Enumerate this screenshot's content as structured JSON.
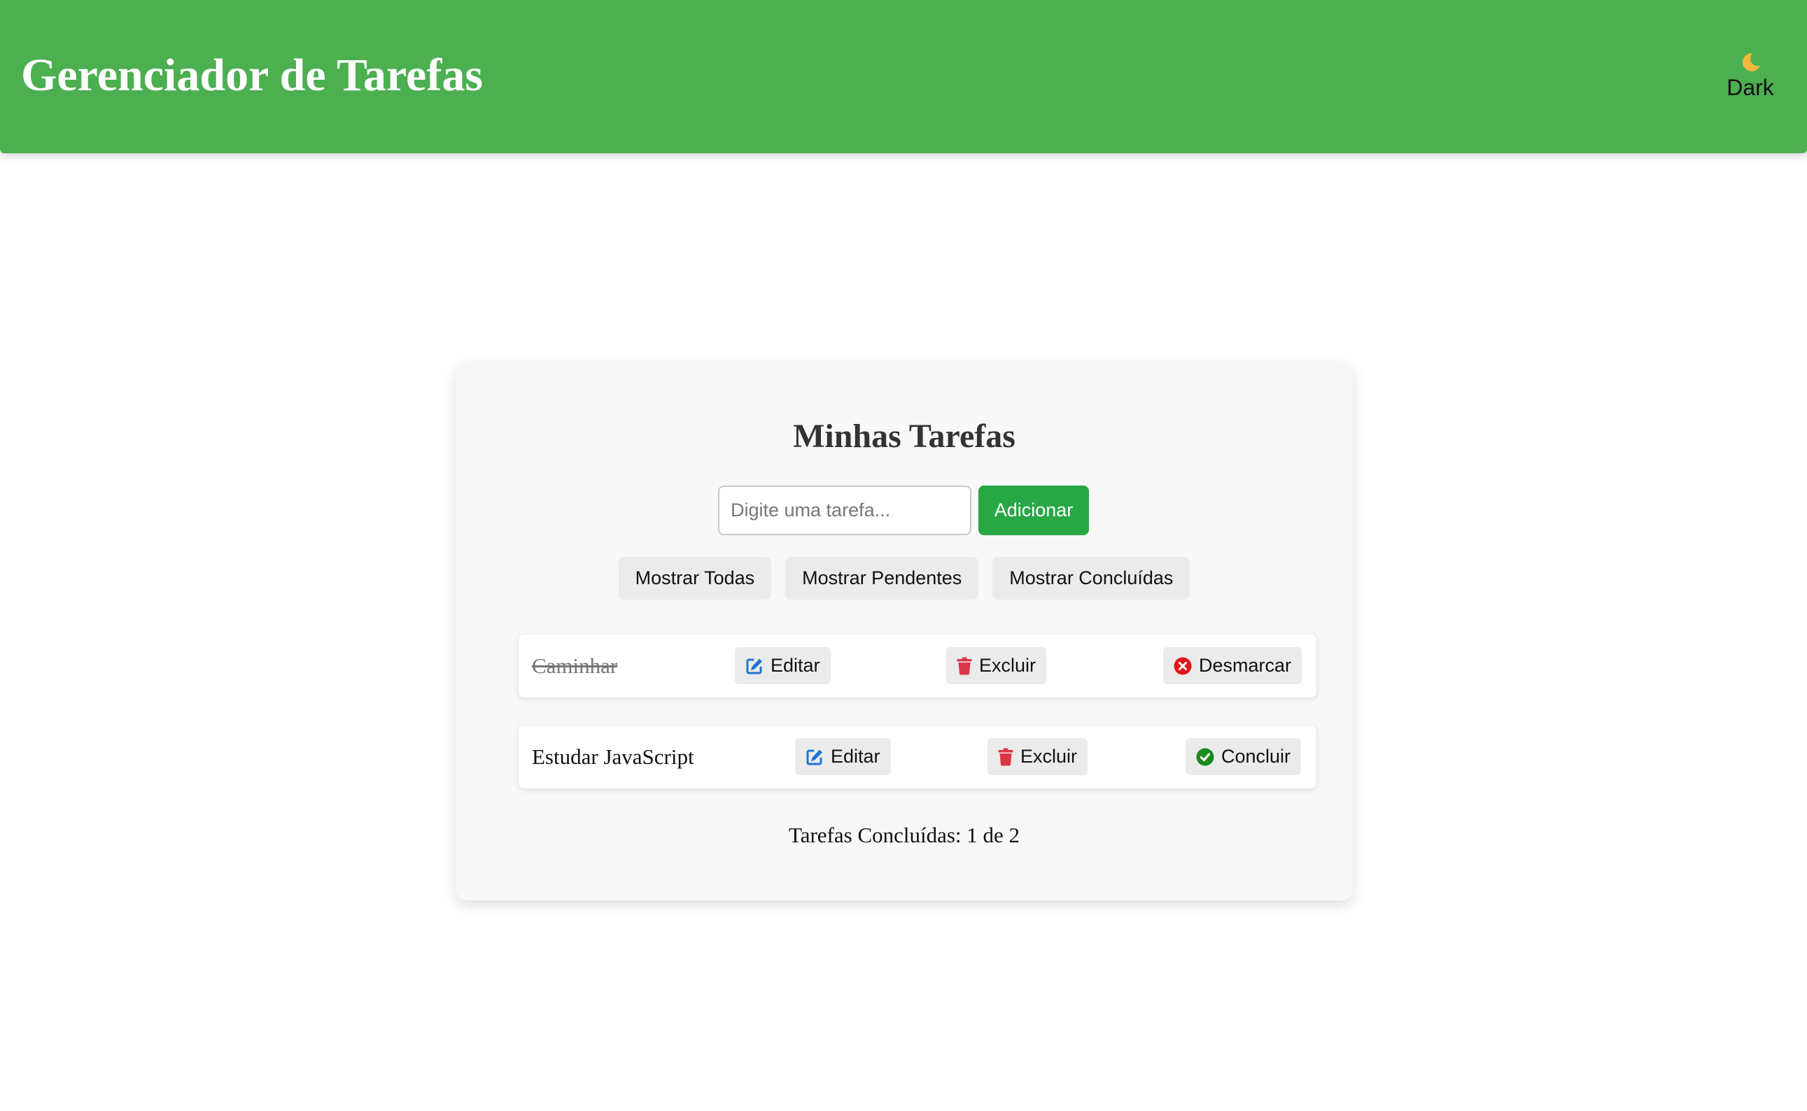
{
  "header": {
    "title": "Gerenciador de Tarefas",
    "theme_toggle_label": "Dark",
    "theme_toggle_icon": "moon-icon",
    "background_color": "#4caf50"
  },
  "main": {
    "title": "Minhas Tarefas",
    "input": {
      "value": "",
      "placeholder": "Digite uma tarefa..."
    },
    "add_button_label": "Adicionar",
    "filters": [
      {
        "label": "Mostrar Todas"
      },
      {
        "label": "Mostrar Pendentes"
      },
      {
        "label": "Mostrar Concluídas"
      }
    ],
    "tasks": [
      {
        "text": "Caminhar",
        "completed": true,
        "edit_label": "Editar",
        "edit_icon": "edit-icon",
        "delete_label": "Excluir",
        "delete_icon": "trash-icon",
        "toggle_label": "Desmarcar",
        "toggle_icon": "x-circle-icon"
      },
      {
        "text": "Estudar JavaScript",
        "completed": false,
        "edit_label": "Editar",
        "edit_icon": "edit-icon",
        "delete_label": "Excluir",
        "delete_icon": "trash-icon",
        "toggle_label": "Concluir",
        "toggle_icon": "check-circle-icon"
      }
    ],
    "summary": "Tarefas Concluídas: 1 de 2"
  },
  "colors": {
    "accent_green": "#28a745",
    "edit_blue": "#1e74d4",
    "delete_red": "#dc3545",
    "uncheck_red": "#e3151c",
    "check_green": "#1a8a1a"
  }
}
